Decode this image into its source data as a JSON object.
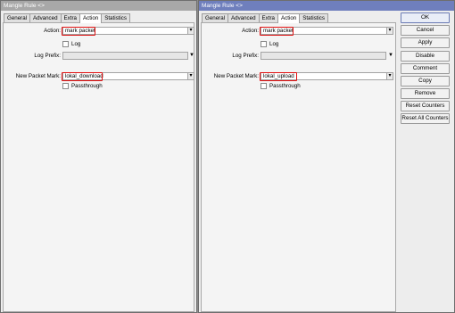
{
  "left_window": {
    "title": "Mangle Rule <>",
    "tabs": [
      "General",
      "Advanced",
      "Extra",
      "Action",
      "Statistics"
    ],
    "active_tab": "Action",
    "action_label": "Action:",
    "action_value": "mark packet",
    "log_label": "Log",
    "log_prefix_label": "Log Prefix:",
    "log_prefix_value": "",
    "new_packet_mark_label": "New Packet Mark:",
    "new_packet_mark_value": "lokal_download",
    "passthrough_label": "Passthrough"
  },
  "right_window": {
    "title": "Mangle Rule <>",
    "tabs": [
      "General",
      "Advanced",
      "Extra",
      "Action",
      "Statistics"
    ],
    "active_tab": "Action",
    "action_label": "Action:",
    "action_value": "mark packet",
    "log_label": "Log",
    "log_prefix_label": "Log Prefix:",
    "log_prefix_value": "",
    "new_packet_mark_label": "New Packet Mark:",
    "new_packet_mark_value": "lokal_upload",
    "passthrough_label": "Passthrough",
    "buttons": [
      "OK",
      "Cancel",
      "Apply",
      "Disable",
      "Comment",
      "Copy",
      "Remove",
      "Reset Counters",
      "Reset All Counters"
    ]
  },
  "icons": {
    "dropdown": "▾",
    "dropdown_small": "▼"
  },
  "colors": {
    "highlight": "#e01010",
    "active_title": "#6f7fbd"
  }
}
